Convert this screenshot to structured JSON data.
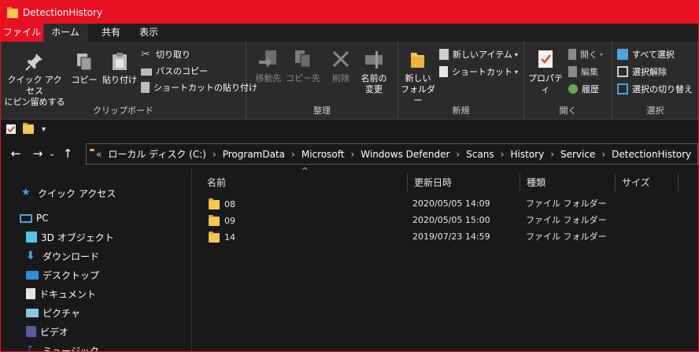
{
  "window": {
    "title": "DetectionHistory",
    "accent": "#e81123"
  },
  "tabs": [
    "ファイル",
    "ホーム",
    "共有",
    "表示"
  ],
  "ribbon": {
    "clipboard": {
      "label": "クリップボード",
      "pin": "クイック アクセス\nにピン留めする",
      "copy": "コピー",
      "paste": "貼り付け",
      "cut": "切り取り",
      "copy_path": "パスのコピー",
      "paste_shortcut": "ショートカットの貼り付け"
    },
    "organize": {
      "label": "整理",
      "move_to": "移動先",
      "copy_to": "コピー先",
      "delete": "削除",
      "rename": "名前の\n変更"
    },
    "new": {
      "label": "新規",
      "new_folder": "新しい\nフォルダー",
      "new_item": "新しいアイテム",
      "shortcut": "ショートカット"
    },
    "open": {
      "label": "開く",
      "properties": "プロパティ",
      "open": "開く",
      "edit": "編集",
      "history": "履歴"
    },
    "select": {
      "label": "選択",
      "select_all": "すべて選択",
      "select_none": "選択解除",
      "invert": "選択の切り替え"
    }
  },
  "address": {
    "prefix": "«",
    "segments": [
      "ローカル ディスク (C:)",
      "ProgramData",
      "Microsoft",
      "Windows Defender",
      "Scans",
      "History",
      "Service",
      "DetectionHistory"
    ],
    "separator": "›"
  },
  "nav_pane": [
    {
      "label": "クイック アクセス",
      "icon": "star-icon"
    },
    {
      "label": "PC",
      "icon": "pc-icon"
    },
    {
      "label": "3D オブジェクト",
      "icon": "cube-icon"
    },
    {
      "label": "ダウンロード",
      "icon": "download-icon"
    },
    {
      "label": "デスクトップ",
      "icon": "desktop-icon"
    },
    {
      "label": "ドキュメント",
      "icon": "document-icon"
    },
    {
      "label": "ピクチャ",
      "icon": "picture-icon"
    },
    {
      "label": "ビデオ",
      "icon": "video-icon"
    },
    {
      "label": "ミュージック",
      "icon": "music-icon"
    }
  ],
  "columns": [
    "名前",
    "更新日時",
    "種類",
    "サイズ"
  ],
  "files": [
    {
      "name": "08",
      "modified": "2020/05/05 14:09",
      "type": "ファイル フォルダー",
      "size": ""
    },
    {
      "name": "09",
      "modified": "2020/05/05 15:00",
      "type": "ファイル フォルダー",
      "size": ""
    },
    {
      "name": "14",
      "modified": "2019/07/23 14:59",
      "type": "ファイル フォルダー",
      "size": ""
    }
  ]
}
